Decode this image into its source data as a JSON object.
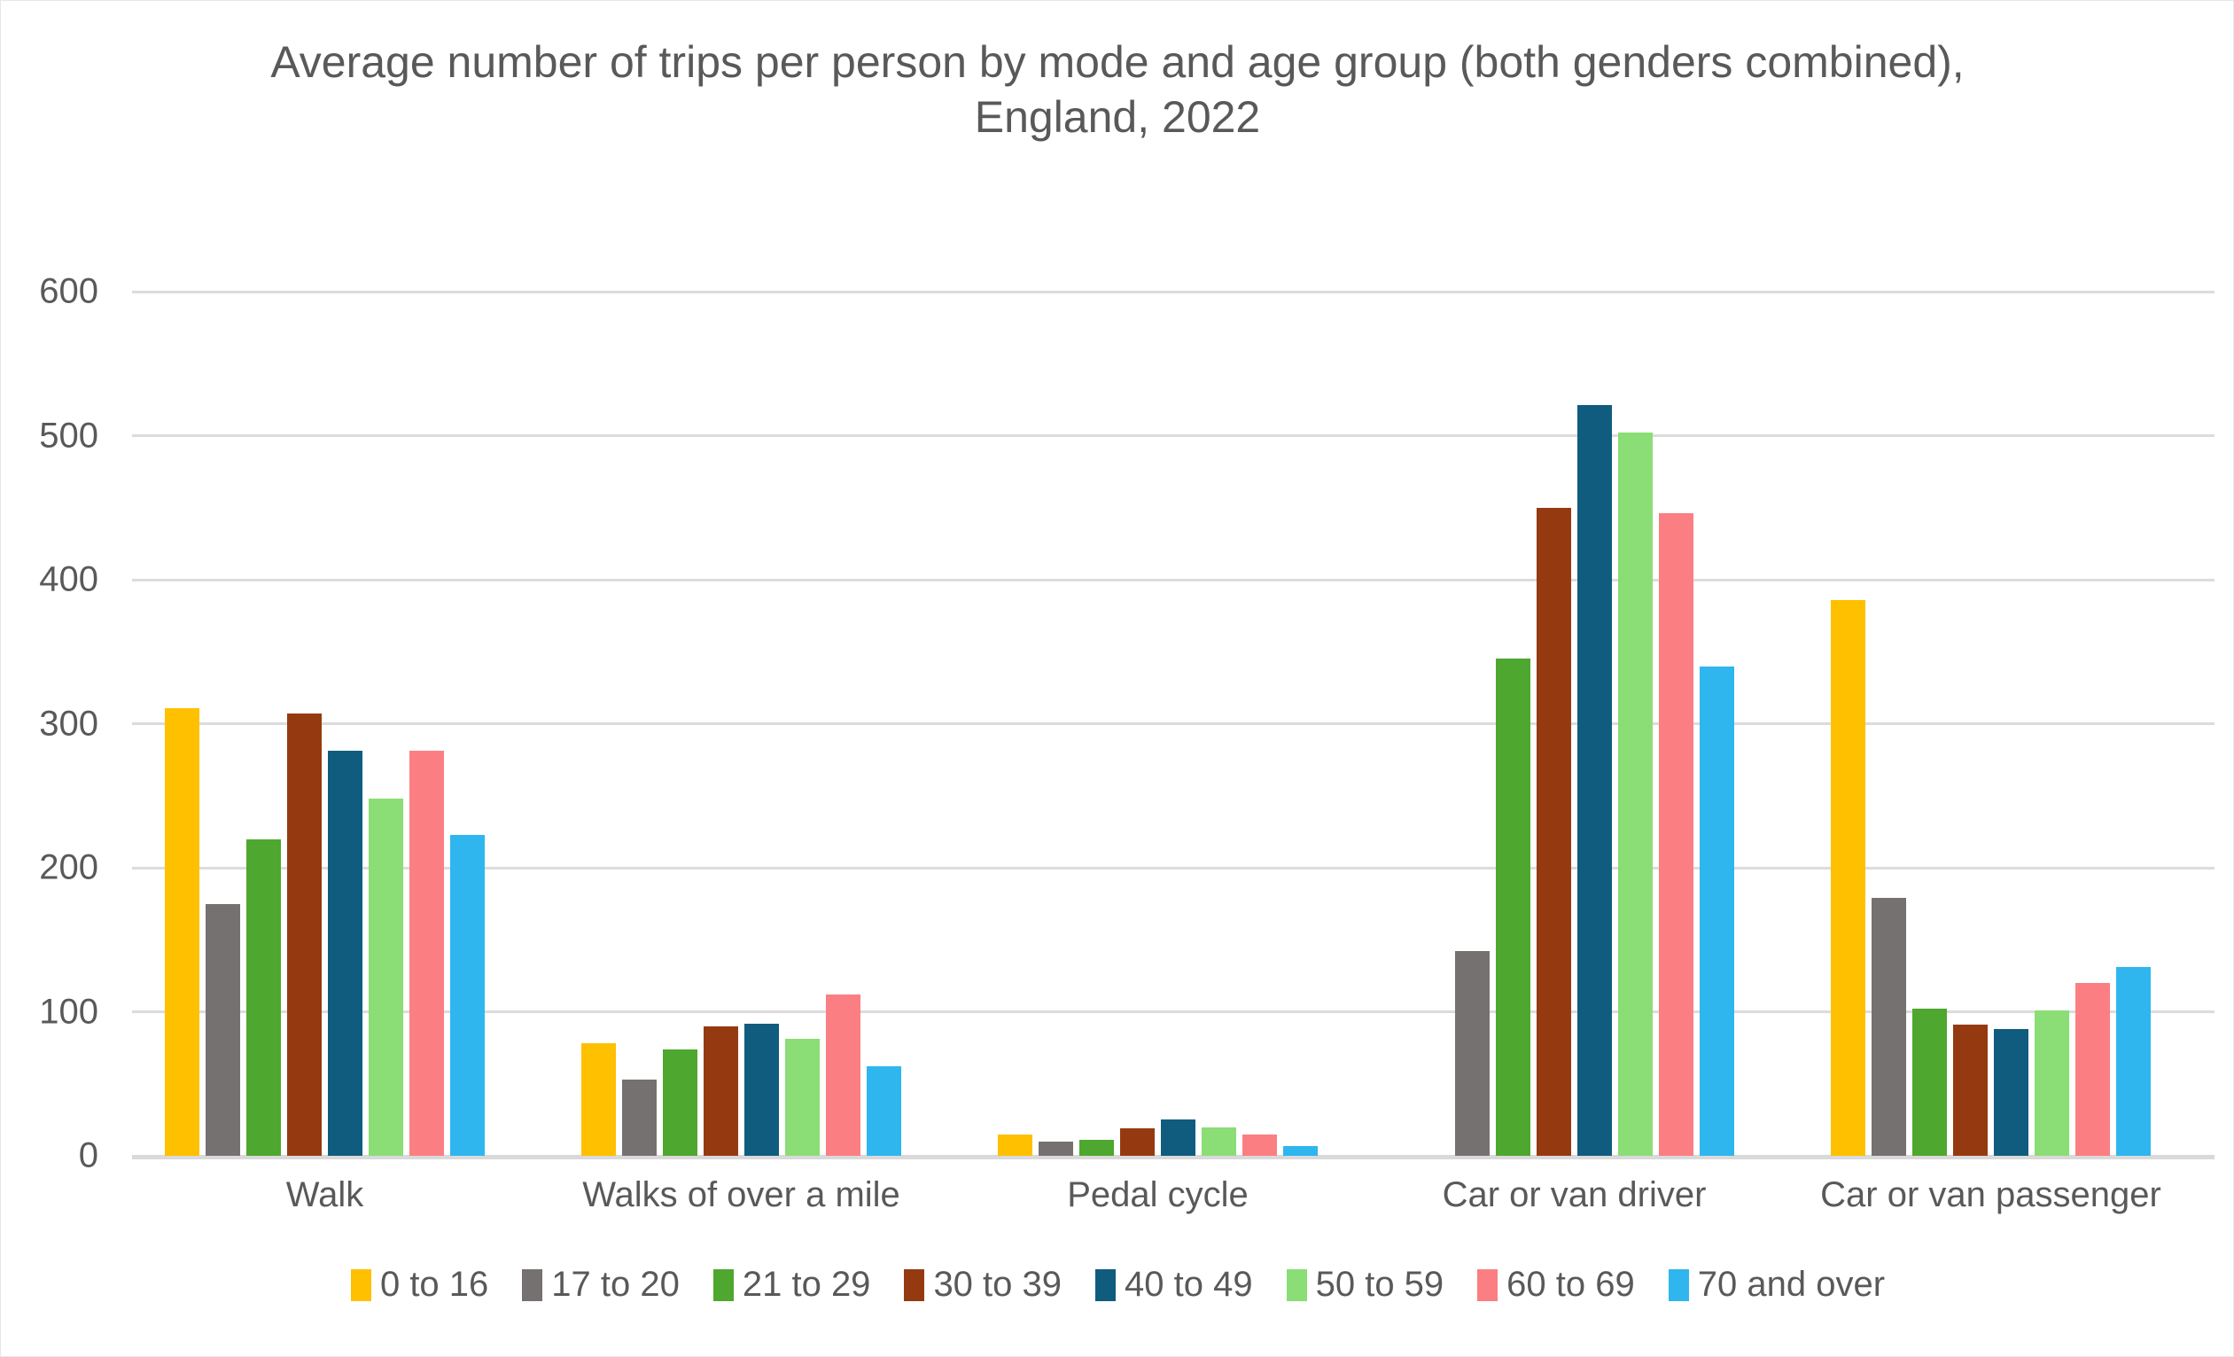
{
  "chart_data": {
    "type": "bar",
    "title": "Average number of trips per person by mode and age group (both genders combined), England, 2022",
    "xlabel": "",
    "ylabel": "",
    "ylim": [
      0,
      600
    ],
    "ytick_values": [
      600,
      500,
      400,
      300,
      200,
      100,
      0
    ],
    "ytick_labels": [
      "600",
      "500",
      "400",
      "300",
      "200",
      "100",
      "0"
    ],
    "grid": true,
    "legend_position": "bottom",
    "categories": [
      "Walk",
      "Walks of over a mile",
      "Pedal cycle",
      "Car or van driver",
      "Car or van passenger"
    ],
    "series": [
      {
        "name": "0 to 16",
        "color": "#FFC000",
        "values": [
          311,
          78,
          15,
          0,
          386
        ]
      },
      {
        "name": "17 to 20",
        "color": "#767171",
        "values": [
          175,
          53,
          10,
          142,
          179
        ]
      },
      {
        "name": "21 to 29",
        "color": "#4EA72E",
        "values": [
          220,
          74,
          11,
          345,
          102
        ]
      },
      {
        "name": "30 to 39",
        "color": "#953A10",
        "values": [
          307,
          90,
          19,
          450,
          91
        ]
      },
      {
        "name": "40 to 49",
        "color": "#0F5C7F",
        "values": [
          281,
          92,
          25,
          521,
          88
        ]
      },
      {
        "name": "50 to 59",
        "color": "#8BDD75",
        "values": [
          248,
          81,
          20,
          502,
          101
        ]
      },
      {
        "name": "60 to 69",
        "color": "#FB7F82",
        "values": [
          281,
          112,
          15,
          446,
          120
        ]
      },
      {
        "name": "70 and over",
        "color": "#2FB6EE",
        "values": [
          223,
          62,
          7,
          340,
          131
        ]
      }
    ]
  },
  "legend": {
    "items": [
      {
        "label": "0 to 16",
        "color": "#FFC000"
      },
      {
        "label": "17 to 20",
        "color": "#767171"
      },
      {
        "label": "21 to 29",
        "color": "#4EA72E"
      },
      {
        "label": "30 to 39",
        "color": "#953A10"
      },
      {
        "label": "40 to 49",
        "color": "#0F5C7F"
      },
      {
        "label": "50 to 59",
        "color": "#8BDD75"
      },
      {
        "label": "60 to 69",
        "color": "#FB7F82"
      },
      {
        "label": "70 and over",
        "color": "#2FB6EE"
      }
    ]
  },
  "colors": {
    "text": "#595959",
    "gridline": "#dcdcdc",
    "background": "#ffffff"
  }
}
